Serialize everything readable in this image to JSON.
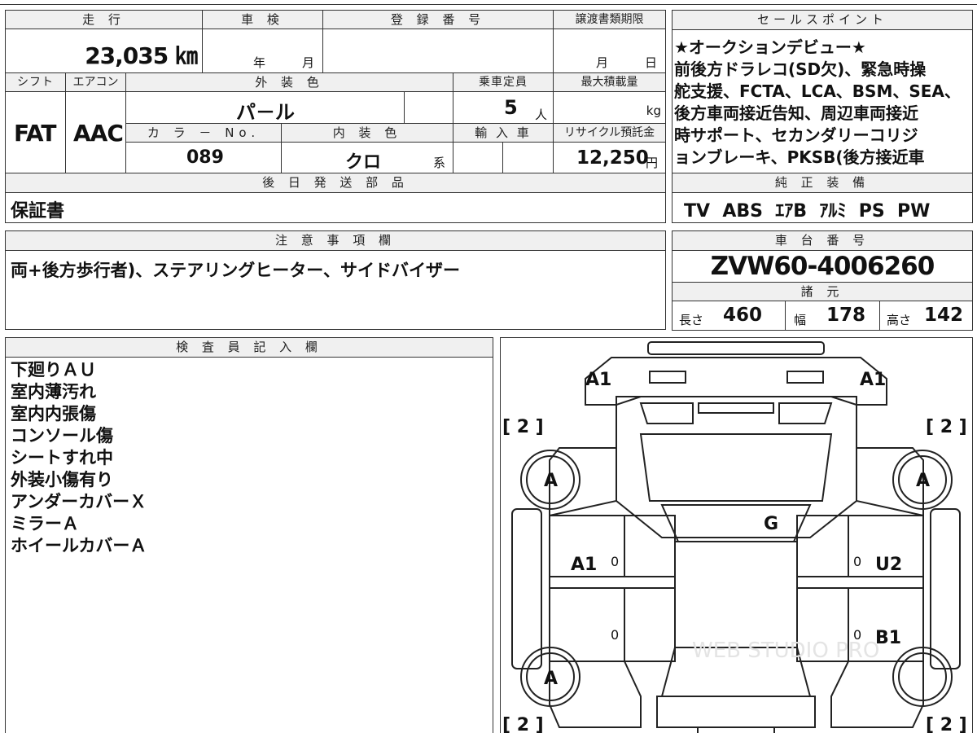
{
  "top": {
    "km_label": "走 行",
    "km_value": "23,035 ㎞",
    "shaken_label": "車 検",
    "shaken_year_unit": "年",
    "shaken_month_unit": "月",
    "reg_label": "登 録 番 号",
    "transfer_label": "譲渡書類期限",
    "transfer_month_unit": "月",
    "transfer_day_unit": "日",
    "shift_label": "シフト",
    "ac_label": "エアコン",
    "exterior_label": "外 装 色",
    "capacity_label": "乗車定員",
    "maxload_label": "最大積載量",
    "shift_value": "FAT",
    "ac_value": "AAC",
    "exterior_value": "パ－ル",
    "capacity_value": "5",
    "capacity_unit": "人",
    "maxload_unit": "kg",
    "colorno_label": "カ ラ － No.",
    "interior_label": "内 装 色",
    "import_label": "輸 入 車",
    "recycle_label": "リサイクル預託金",
    "colorno_value": "089",
    "interior_value": "クロ",
    "interior_suffix": "系",
    "recycle_value": "12,250",
    "recycle_unit": "円"
  },
  "later_parts": {
    "label": "後 日 発 送 部 品",
    "value": "保証書"
  },
  "sales_point": {
    "label": "セールスポイント",
    "lines": [
      "★オークションデビュー★",
      "前後方ドラレコ(SD欠)、緊急時操",
      "舵支援、FCTA、LCA、BSM、SEA、",
      "後方車両接近告知、周辺車両接近",
      "時サポート、セカンダリーコリジ",
      "ョンブレーキ、PKSB(後方接近車"
    ]
  },
  "equipment": {
    "label": "純 正 装 備",
    "value": "TV  ABS  ｴｱB  ｱﾙﾐ  PS  PW"
  },
  "notes": {
    "label": "注 意 事 項 欄",
    "value": "両+後方歩行者)、ステアリングヒーター、サイドバイザー"
  },
  "chassis": {
    "label": "車 台 番 号",
    "value": "ZVW60-4006260"
  },
  "specs": {
    "label": "諸 元",
    "length_label": "長さ",
    "length_value": "460",
    "width_label": "幅",
    "width_value": "178",
    "height_label": "高さ",
    "height_value": "142"
  },
  "inspector": {
    "label": "検 査 員 記 入 欄",
    "lines": [
      "下廻りＡＵ",
      "室内薄汚れ",
      "室内内張傷",
      "コンソール傷",
      "シートすれ中",
      "外装小傷有り",
      "アンダーカバーＸ",
      "ミラーＡ",
      "ホイールカバーＡ"
    ]
  },
  "diagram": {
    "front_left": "A1",
    "front_right": "A1",
    "bracket_tl": "[ 2 ]",
    "bracket_tr": "[ 2 ]",
    "bracket_bl": "[ 2 ]",
    "bracket_br": "[ 2 ]",
    "wheel_fl": "A",
    "wheel_fr": "A",
    "wheel_rl": "A",
    "windshield": "G",
    "door_fl": "A1",
    "door_fr": "U2",
    "door_rr": "B1",
    "zero_1": "0",
    "zero_2": "0",
    "zero_3": "0",
    "zero_4": "0",
    "watermark": "WEB STUDIO PRO"
  },
  "colors": {
    "border": "#333333",
    "header_bg": "#f0f0f0",
    "text": "#111111"
  }
}
